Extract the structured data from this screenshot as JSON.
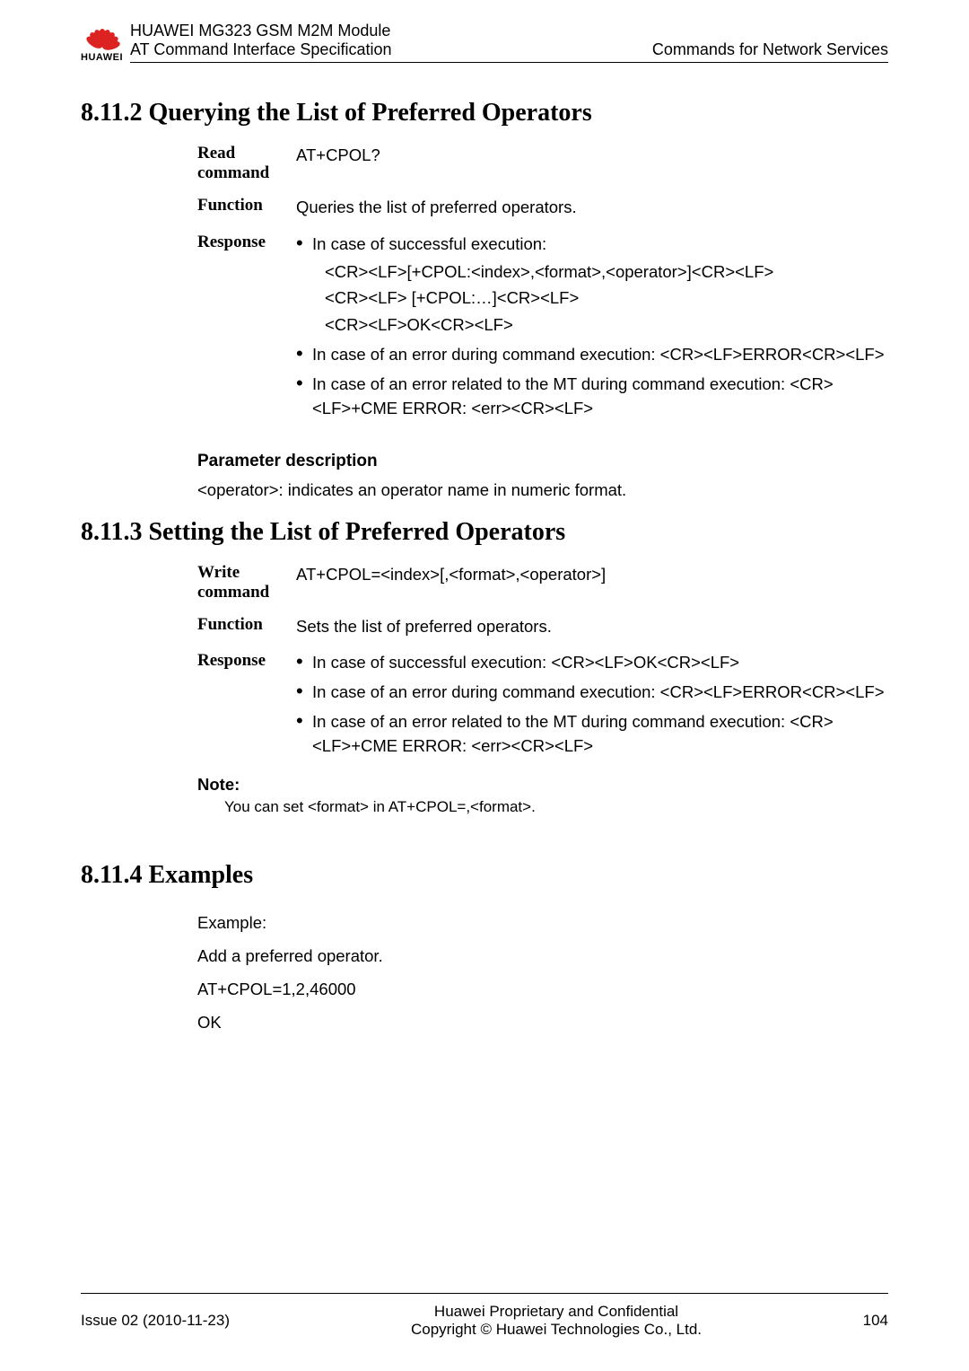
{
  "header": {
    "brand": "HUAWEI",
    "module_title": "HUAWEI MG323 GSM M2M Module",
    "spec_title": "AT Command Interface Specification",
    "section_right": "Commands for Network Services"
  },
  "s1": {
    "heading": "8.11.2 Querying the List of Preferred Operators",
    "read_label": "Read command",
    "read_cmd": "AT+CPOL?",
    "function_label": "Function",
    "function_text": "Queries the list of preferred operators.",
    "response_label": "Response",
    "resp_b1": "In case of successful execution:",
    "resp_b1_l1": "<CR><LF>[+CPOL:<index>,<format>,<operator>]<CR><LF>",
    "resp_b1_l2": "<CR><LF> [+CPOL:…]<CR><LF>",
    "resp_b1_l3": "<CR><LF>OK<CR><LF>",
    "resp_b2": "In case of an error during command execution: <CR><LF>ERROR<CR><LF>",
    "resp_b3": "In case of an error related to the MT during command execution: <CR><LF>+CME ERROR: <err><CR><LF>",
    "param_heading": "Parameter description",
    "param_text": "<operator>: indicates an operator name in numeric format."
  },
  "s2": {
    "heading": "8.11.3 Setting the List of Preferred Operators",
    "write_label": "Write command",
    "write_cmd": "AT+CPOL=<index>[,<format>,<operator>]",
    "function_label": "Function",
    "function_text": "Sets the list of preferred operators.",
    "response_label": "Response",
    "resp_b1": "In case of successful execution: <CR><LF>OK<CR><LF>",
    "resp_b2": "In case of an error during command execution: <CR><LF>ERROR<CR><LF>",
    "resp_b3": "In case of an error related to the MT during command execution: <CR><LF>+CME ERROR: <err><CR><LF>",
    "note_label": "Note:",
    "note_text": "You can set <format> in AT+CPOL=,<format>."
  },
  "s3": {
    "heading": "8.11.4 Examples",
    "l1": "Example:",
    "l2": "Add a preferred operator.",
    "l3": "AT+CPOL=1,2,46000",
    "l4": "OK"
  },
  "footer": {
    "issue": "Issue 02 (2010-11-23)",
    "c1": "Huawei Proprietary and Confidential",
    "c2": "Copyright © Huawei Technologies Co., Ltd.",
    "page": "104"
  }
}
